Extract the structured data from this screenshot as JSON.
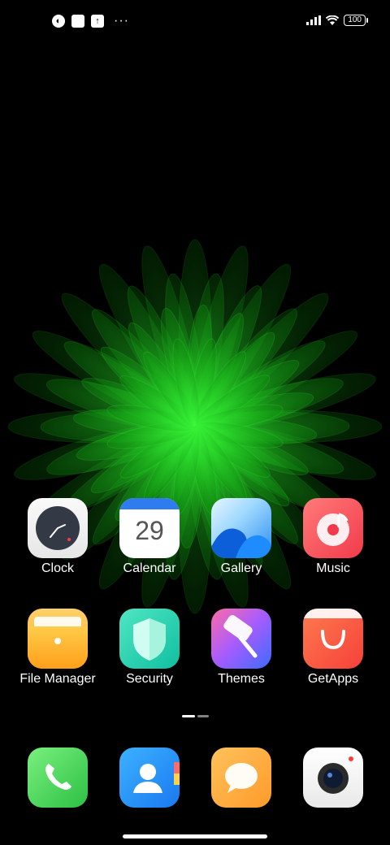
{
  "status_bar": {
    "left_icons": [
      "app-notification-icon",
      "square-notification-icon",
      "upload-icon"
    ],
    "more_indicator": "···",
    "right_icons": [
      "signal-icon",
      "wifi-icon"
    ],
    "battery": "100"
  },
  "wallpaper": {
    "accent": "#13c613"
  },
  "apps_row1": [
    {
      "label": "Clock",
      "icon": "clock-icon"
    },
    {
      "label": "Calendar",
      "icon": "calendar-icon",
      "day": "29"
    },
    {
      "label": "Gallery",
      "icon": "gallery-icon"
    },
    {
      "label": "Music",
      "icon": "music-icon"
    }
  ],
  "apps_row2": [
    {
      "label": "File Manager",
      "icon": "folder-icon"
    },
    {
      "label": "Security",
      "icon": "shield-icon"
    },
    {
      "label": "Themes",
      "icon": "paint-roller-icon"
    },
    {
      "label": "GetApps",
      "icon": "shopping-bag-icon"
    }
  ],
  "dock": [
    {
      "icon": "phone-icon"
    },
    {
      "icon": "contacts-icon"
    },
    {
      "icon": "messaging-icon"
    },
    {
      "icon": "camera-icon"
    }
  ],
  "page_indicator": {
    "pages": 2,
    "current": 1
  }
}
